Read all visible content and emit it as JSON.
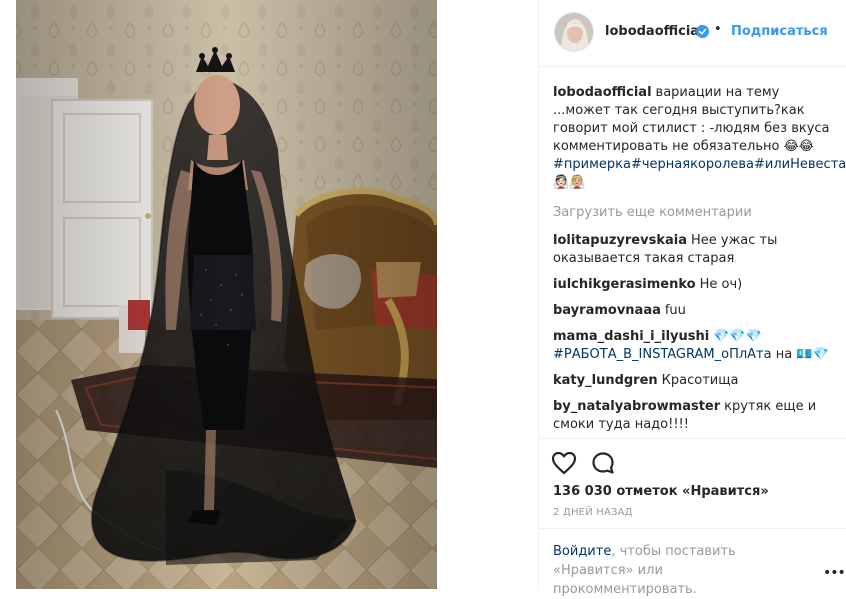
{
  "post": {
    "username": "lobodaofficial",
    "separator": "•",
    "follow_label": "Подписаться",
    "caption": {
      "username": "lobodaofficial",
      "text": "вариации на тему ...может так сегодня выступить?как говорит мой стилист : -людям без вкуса комментировать не обязательно 😂😂",
      "hashtags": "#примерка#чернаякоролева#илиНевеста 👰🏻👰🏼"
    },
    "load_more_label": "Загрузить еще комментарии",
    "comments": [
      {
        "username": "lolitapuzyrevskaia",
        "text": "Нее ужас ты оказывается такая старая"
      },
      {
        "username": "iulchikgerasimenko",
        "text": "Не оч)"
      },
      {
        "username": "bayramovnaaa",
        "text": "fuu"
      },
      {
        "username": "mama_dashi_i_ilyushi",
        "text": "💎💎💎",
        "tag": "#РАБОТА_В_INSTAGRAM_оПлАта",
        "tail": " на 💶💎"
      },
      {
        "username": "katy_lundgren",
        "text": "Красотища"
      },
      {
        "username": "by_natalyabrowmaster",
        "text": "крутяк еще и смоки туда надо!!!!"
      }
    ],
    "likes_label": "136 030 отметок «Нравится»",
    "time_label": "2 ДНЕЙ НАЗАД",
    "login": {
      "link": "Войдите",
      "text": ", чтобы поставить «Нравится» или прокомментировать."
    },
    "more_icon": "•••"
  },
  "icons": {
    "verified": "verified-icon",
    "heart": "heart-icon",
    "comment": "comment-icon",
    "more": "more-options-icon"
  },
  "colors": {
    "link": "#3897f0",
    "hashtag": "#003569",
    "muted": "#999999",
    "text": "#262626"
  }
}
